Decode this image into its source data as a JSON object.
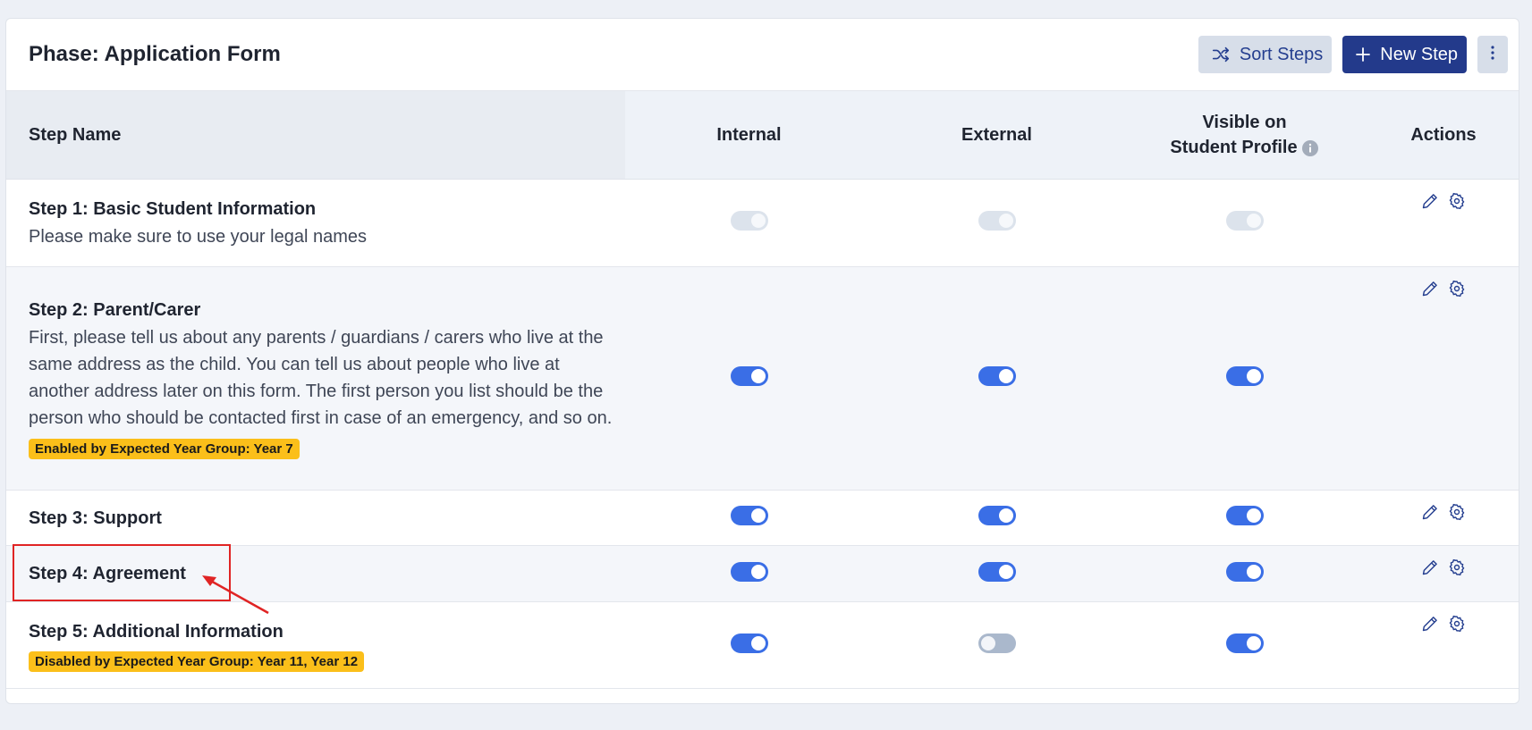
{
  "header": {
    "title": "Phase: Application Form",
    "sort_label": "Sort Steps",
    "new_label": "New Step",
    "more_icon": "kebab-menu-icon"
  },
  "table": {
    "columns": {
      "name": "Step Name",
      "internal": "Internal",
      "external": "External",
      "visible_line1": "Visible on",
      "visible_line2": "Student Profile",
      "actions": "Actions"
    },
    "rows": [
      {
        "title": "Step 1: Basic Student Information",
        "description": "Please make sure to use your legal names",
        "badge": "",
        "internal": "disabled-on",
        "external": "disabled-on",
        "visible": "disabled-on"
      },
      {
        "title": "Step 2: Parent/Carer",
        "description": "First, please tell us about any parents / guardians / carers who live at the same address as the child. You can tell us about people who live at another address later on this form. The first person you list should be the person who should be contacted first in case of an emergency, and so on.",
        "badge": "Enabled by Expected Year Group: Year 7",
        "internal": "on",
        "external": "on",
        "visible": "on"
      },
      {
        "title": "Step 3: Support",
        "description": "",
        "badge": "",
        "internal": "on",
        "external": "on",
        "visible": "on"
      },
      {
        "title": "Step 4: Agreement",
        "description": "",
        "badge": "",
        "internal": "on",
        "external": "on",
        "visible": "on"
      },
      {
        "title": "Step 5: Additional Information",
        "description": "",
        "badge": "Disabled by Expected Year Group: Year 11, Year 12",
        "internal": "on",
        "external": "off",
        "visible": "on"
      }
    ]
  },
  "colors": {
    "primary": "#233a8b",
    "toggle_on": "#3a6ee6",
    "badge": "#fbbf1a",
    "annotation": "#e02424"
  }
}
